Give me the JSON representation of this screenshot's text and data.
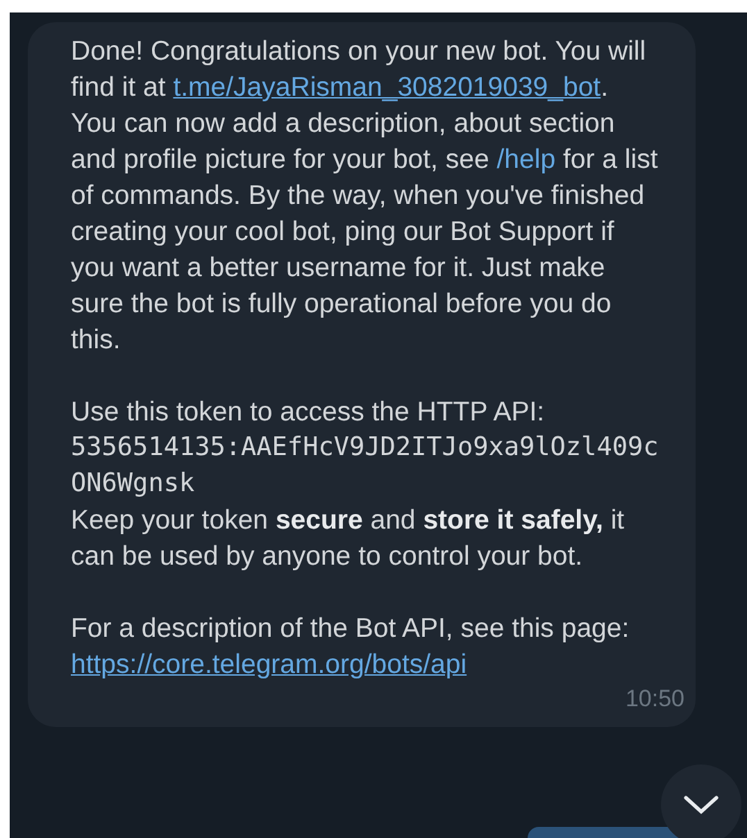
{
  "message": {
    "sections": [
      [
        {
          "kind": "text",
          "runs": [
            {
              "kind": "text",
              "text": "Done! Congratulations on your new bot. You will find it at "
            },
            {
              "kind": "link",
              "text": "t.me/JayaRisman_3082019039_bot"
            },
            {
              "kind": "text",
              "text": ". You can now add a description, about section and profile picture for your bot, see "
            },
            {
              "kind": "link",
              "text": "/help"
            },
            {
              "kind": "text",
              "text": " for a list of commands. By the way, when you've finished creating your cool bot, ping our Bot Support if you want a better username for it. Just make sure the bot is fully operational before you do this."
            }
          ]
        }
      ],
      [
        {
          "kind": "text",
          "runs": [
            {
              "kind": "text",
              "text": "Use this token to access the HTTP API:"
            }
          ]
        },
        {
          "kind": "code",
          "runs": [
            {
              "kind": "text",
              "text": "5356514135:AAEfHcV9JD2ITJo9xa9lOzl409cON6Wgnsk"
            }
          ]
        },
        {
          "kind": "text",
          "runs": [
            {
              "kind": "text",
              "text": "Keep your token **secure** and **store it safely,** it can be used by anyone to control your bot."
            }
          ]
        }
      ],
      [
        {
          "kind": "text",
          "runs": [
            {
              "kind": "text",
              "text": "For a description of the Bot API, see this page: "
            },
            {
              "kind": "link",
              "text": "https://core.telegram.org/bots/api"
            }
          ]
        }
      ]
    ],
    "time": "10:50"
  },
  "scroll_down_button": {
    "kind": "chevron"
  }
}
